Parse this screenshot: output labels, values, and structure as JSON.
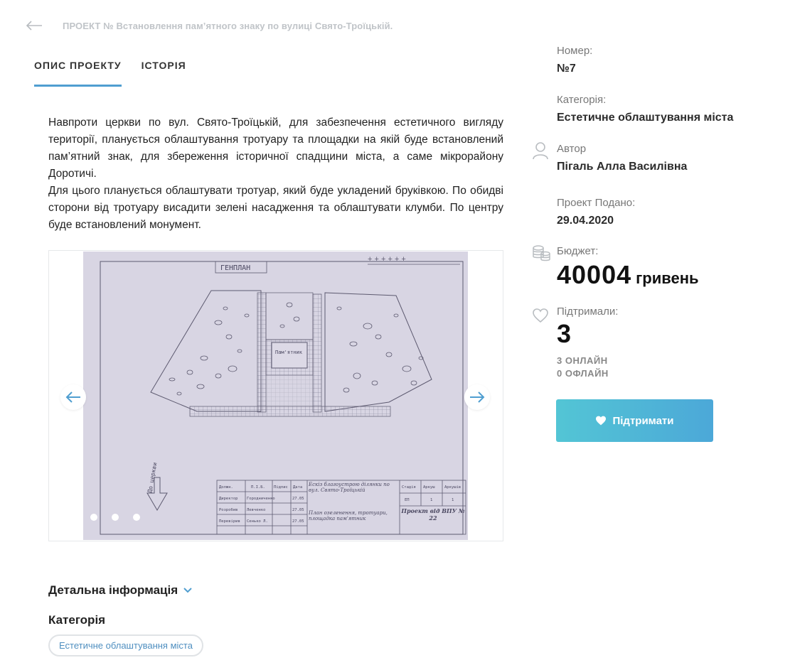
{
  "header": {
    "breadcrumb": "ПРОЕКТ № Встановлення пам’ятного знаку по вулиці Свято-Троїцькій."
  },
  "tabs": [
    {
      "label": "ОПИС ПРОЕКТУ",
      "active": true
    },
    {
      "label": "ІСТОРІЯ",
      "active": false
    }
  ],
  "description": {
    "p1": "Навпроти церкви по вул. Свято-Троїцькій, для забезпечення естетичного вигляду території, планується облаштування тротуару та площадки на якій буде встановлений пам’ятний знак, для збереження історичної спадщини міста, а саме мікрорайону Доротичі.",
    "p2": "Для цього планується облаштувати тротуар, який буде укладений бруківкою. По обидві сторони від тротуару висадити зелені насадження та облаштувати клумби. По центру буде встановлений монумент."
  },
  "slider": {
    "image_caption": "ГЕНПЛАН",
    "image_text": [
      "Пам'ятник",
      "До церкви",
      "Ескіз благоустрою ділянки по вул. Свято-Троїцькій",
      "План озеленення, тротуари, площадка пам'ятник",
      "Проект від ВПУ № 22",
      "Должн.",
      "П.І.Б.",
      "Підпис",
      "Дата",
      "Стадія",
      "Аркуш",
      "Аркушів",
      "ЕП",
      "1",
      "1",
      "Директор",
      "Розробив",
      "Перевірив",
      "Городниченко",
      "Левченко",
      "Сенько Л.",
      "27.05",
      "27.05",
      "27.05"
    ],
    "dots": 3,
    "active_dot": 0
  },
  "details": {
    "toggle_label": "Детальна інформація",
    "category_title": "Категорія",
    "category_chip": "Естетичне облаштування міста"
  },
  "sidebar": {
    "number_label": "Номер:",
    "number_value": "№7",
    "category_label": "Категорія:",
    "category_value": "Естетичне облаштування міста",
    "author_label": "Автор",
    "author_value": "Пігаль Алла Василівна",
    "submitted_label": "Проект Подано:",
    "submitted_value": "29.04.2020",
    "budget_label": "Бюджет:",
    "budget_value": "40004",
    "budget_currency": "гривень",
    "supported_label": "Підтримали:",
    "supported_value": "3",
    "online": "3 ОНЛАЙН",
    "offline": "0 ОФЛАЙН",
    "support_button": "Підтримати"
  },
  "colors": {
    "accent": "#4f9ed0",
    "button_start": "#53c5d5",
    "button_end": "#4ca8d8",
    "muted": "#c0c4c8"
  },
  "icons": [
    "arrow-left-icon",
    "user-icon",
    "coins-icon",
    "heart-outline-icon",
    "heart-icon",
    "chevron-down-icon",
    "arrow-prev-icon",
    "arrow-next-icon"
  ]
}
